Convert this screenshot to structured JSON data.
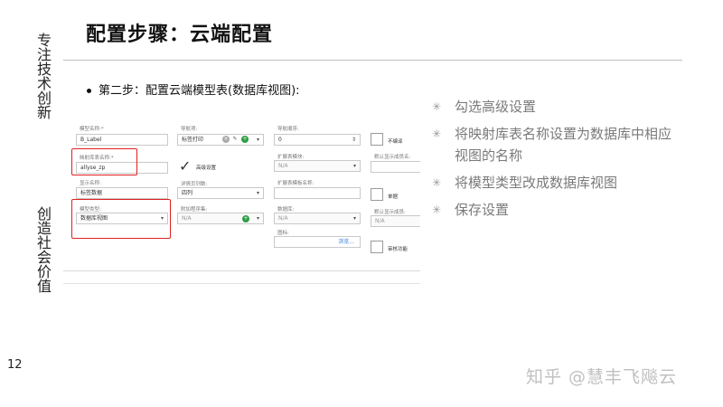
{
  "slide": {
    "title": "配置步骤：云端配置",
    "side_text_top": "专注技术创新",
    "side_text_bottom": "创造社会价值",
    "step_text": "第二步：配置云端模型表(数据库视图):",
    "page_number": "12",
    "watermark": "知乎 @慧丰飞飚云"
  },
  "bullets": [
    "勾选高级设置",
    "将映射库表名称设置为数据库中相应视图的名称",
    "将模型类型改成数据库视图",
    "保存设置"
  ],
  "form": {
    "col1": {
      "model_name_label": "模型名称:*",
      "model_name_value": "B_Label",
      "mapping_table_label": "映射库表名称:*",
      "mapping_table_value": "allyse_zp",
      "display_name_label": "显示名称:",
      "display_name_value": "标签数据",
      "model_type_label": "模型类型:",
      "model_type_value": "数据库视图"
    },
    "col2": {
      "nav_label": "导航项:",
      "nav_value": "标签打印",
      "advanced_label": "高级设置",
      "detail_label": "详情页列数:",
      "detail_value": "四列",
      "attach_label": "附加程序集:",
      "attach_value": "N/A"
    },
    "col3": {
      "nav_order_label": "导航顺序:",
      "nav_order_value": "0",
      "ext_module_label": "扩展表模块:",
      "ext_module_value": "N/A",
      "ext_table_label": "扩展表模板名称:",
      "ext_table_value": "",
      "db_label": "数据库:",
      "db_value": "N/A",
      "icon_label": "图标:",
      "browse_label": "浏览..."
    },
    "col4": {
      "no_translate_label": "不编译",
      "default_display_label": "默认显示成员名:",
      "single_label": "单据",
      "default_display2_label": "默认显示成员:",
      "default_display2_value": "N/A",
      "audit_label": "审核功能"
    }
  },
  "colors": {
    "highlight": "#e02020",
    "bullet_text": "#7a7a7a"
  }
}
